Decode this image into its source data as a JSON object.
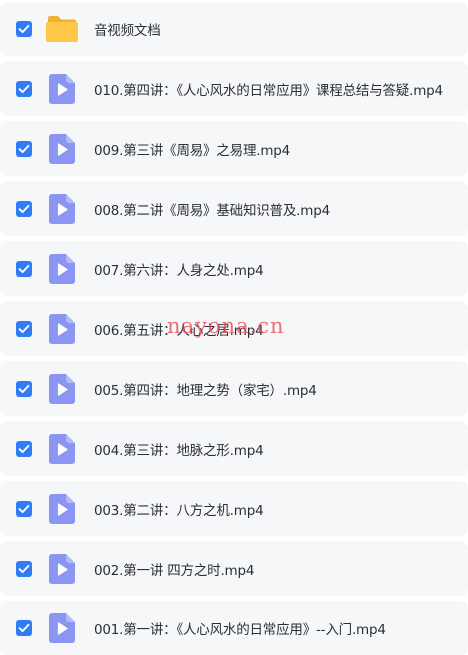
{
  "colors": {
    "row_bg": "#f6f7f9",
    "checkbox": "#2f7cf6",
    "video_icon": "#8b95f3",
    "folder": "#ffc848",
    "text": "#2b2f36",
    "watermark": "#eb4650"
  },
  "files": [
    {
      "name": "音视频文档",
      "type": "folder",
      "icon": "folder-icon",
      "checked": true
    },
    {
      "name": "010.第四讲：《人心风水的日常应用》课程总结与答疑.mp4",
      "type": "video",
      "icon": "video-file-icon",
      "checked": true
    },
    {
      "name": "009.第三讲《周易》之易理.mp4",
      "type": "video",
      "icon": "video-file-icon",
      "checked": true
    },
    {
      "name": "008.第二讲《周易》基础知识普及.mp4",
      "type": "video",
      "icon": "video-file-icon",
      "checked": true
    },
    {
      "name": "007.第六讲：人身之处.mp4",
      "type": "video",
      "icon": "video-file-icon",
      "checked": true
    },
    {
      "name": "006.第五讲：人心之居.mp4",
      "type": "video",
      "icon": "video-file-icon",
      "checked": true
    },
    {
      "name": "005.第四讲：地理之势（家宅）.mp4",
      "type": "video",
      "icon": "video-file-icon",
      "checked": true
    },
    {
      "name": "004.第三讲：地脉之形.mp4",
      "type": "video",
      "icon": "video-file-icon",
      "checked": true
    },
    {
      "name": "003.第二讲：八方之机.mp4",
      "type": "video",
      "icon": "video-file-icon",
      "checked": true
    },
    {
      "name": "002.第一讲 四方之时.mp4",
      "type": "video",
      "icon": "video-file-icon",
      "checked": true
    },
    {
      "name": "001.第一讲：《人心风水的日常应用》--入门.mp4",
      "type": "video",
      "icon": "video-file-icon",
      "checked": true
    }
  ],
  "watermark": {
    "text": "nayona.cn"
  }
}
